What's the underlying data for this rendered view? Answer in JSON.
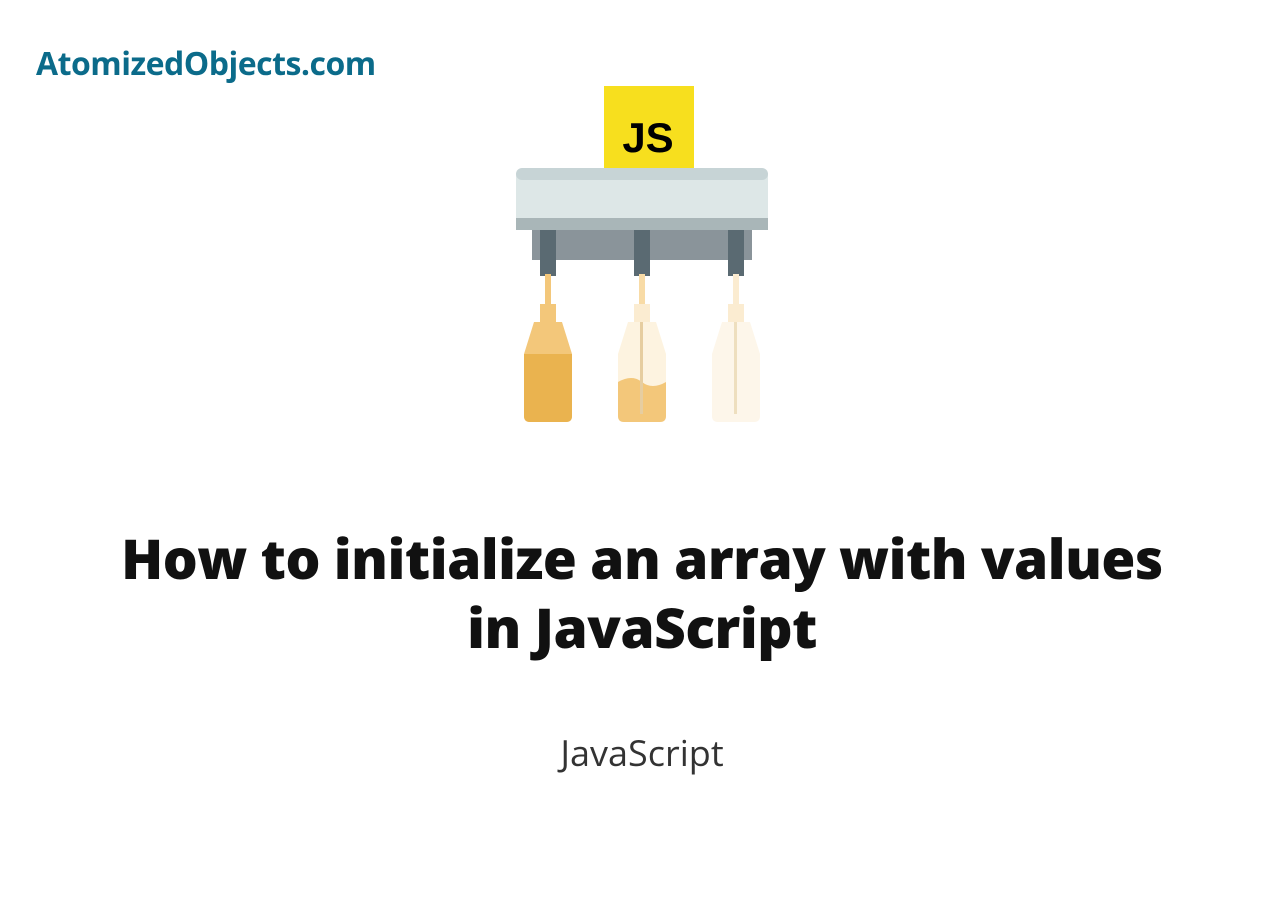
{
  "site": {
    "title": "AtomizedObjects.com"
  },
  "hero": {
    "badge_text": "JS"
  },
  "article": {
    "title": "How to initialize an array with values in JavaScript",
    "category": "JavaScript"
  }
}
